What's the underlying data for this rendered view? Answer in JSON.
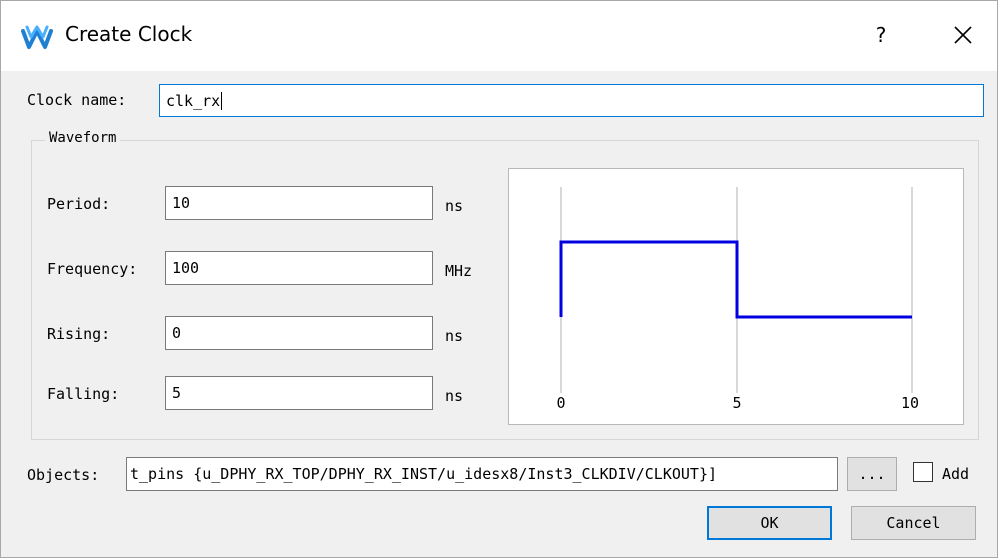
{
  "window": {
    "title": "Create Clock",
    "icon": "gowin-logo-icon",
    "help_label": "?",
    "close_icon": "close-icon"
  },
  "clock_name": {
    "label": "Clock name:",
    "value": "clk_rx"
  },
  "waveform": {
    "group_title": "Waveform",
    "period": {
      "label": "Period:",
      "value": "10",
      "unit": "ns"
    },
    "frequency": {
      "label": "Frequency:",
      "value": "100",
      "unit": "MHz"
    },
    "rising": {
      "label": "Rising:",
      "value": "0",
      "unit": "ns"
    },
    "falling": {
      "label": "Falling:",
      "value": "5",
      "unit": "ns"
    },
    "preview": {
      "ticks": [
        "0",
        "5",
        "10"
      ],
      "waveform_color": "#0000e0",
      "gridline_color": "#d8d8d8"
    }
  },
  "objects": {
    "label": "Objects:",
    "value": "t_pins {u_DPHY_RX_TOP/DPHY_RX_INST/u_idesx8/Inst3_CLKDIV/CLKOUT}]",
    "browse_label": "...",
    "add_label": "Add",
    "add_checked": false
  },
  "buttons": {
    "ok": "OK",
    "cancel": "Cancel"
  },
  "colors": {
    "accent": "#0078d7",
    "dialog_bg": "#f0f0f0"
  }
}
